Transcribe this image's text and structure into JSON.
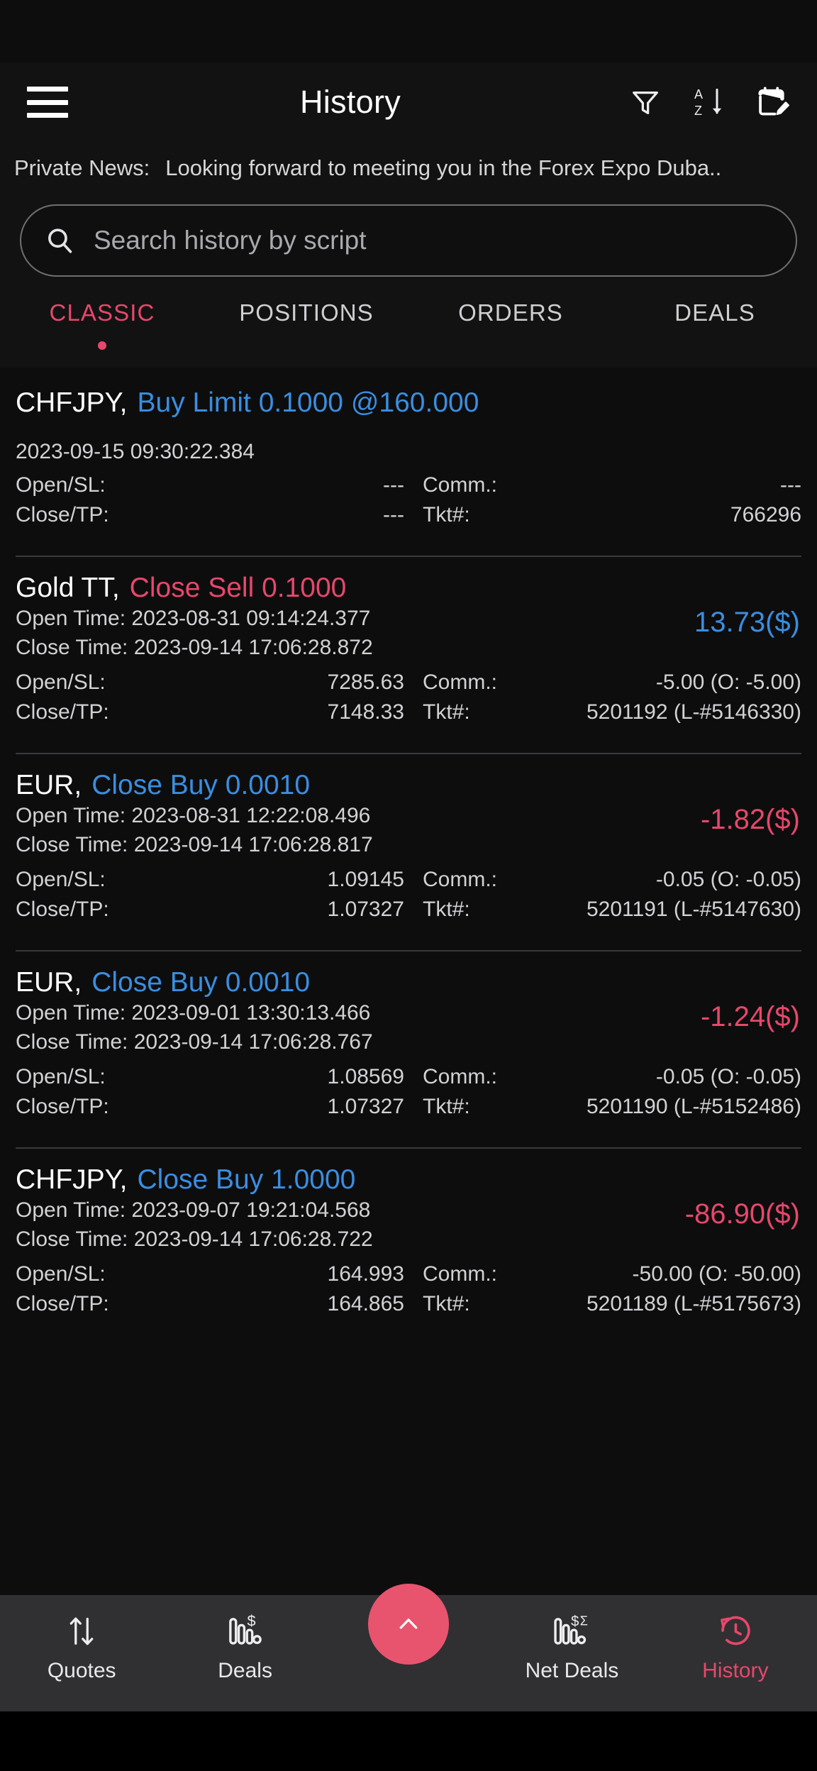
{
  "app": {
    "title": "History",
    "menu_icon": "hamburger-menu-icon",
    "actions": [
      {
        "name": "filter-icon",
        "label": "Filter"
      },
      {
        "name": "sort-az-icon",
        "label": "Sort A-Z"
      },
      {
        "name": "calendar-edit-icon",
        "label": "Date Range"
      }
    ]
  },
  "news": {
    "label": "Private News:",
    "text": "Looking forward to meeting you in the Forex Expo Duba.."
  },
  "search": {
    "placeholder": "Search history by script",
    "value": "",
    "icon": "search-icon"
  },
  "tabs": [
    {
      "label": "CLASSIC",
      "active": true
    },
    {
      "label": "POSITIONS",
      "active": false
    },
    {
      "label": "ORDERS",
      "active": false
    },
    {
      "label": "DEALS",
      "active": false
    }
  ],
  "labels": {
    "open_sl": "Open/SL:",
    "close_tp": "Close/TP:",
    "comm": "Comm.:",
    "ticket": "Tkt#:",
    "open_time": "Open Time:",
    "close_time": "Close Time:"
  },
  "entries": [
    {
      "type": "pending",
      "symbol": "CHFJPY,",
      "action": "Buy Limit 0.1000 @160.000",
      "action_color": "buy",
      "timestamp": "2023-09-15 09:30:22.384",
      "pnl": "",
      "pnl_sign": "",
      "open_sl": "---",
      "close_tp": "---",
      "comm": "---",
      "ticket": "766296"
    },
    {
      "type": "closed",
      "symbol": "Gold TT,",
      "action": "Close Sell 0.1000",
      "action_color": "sell",
      "open_time": "Open Time: 2023-08-31 09:14:24.377",
      "close_time": "Close Time: 2023-09-14 17:06:28.872",
      "pnl": "13.73($)",
      "pnl_sign": "pos",
      "open_sl": "7285.63",
      "close_tp": "7148.33",
      "comm": "-5.00 (O: -5.00)",
      "ticket": "5201192 (L-#5146330)"
    },
    {
      "type": "closed",
      "symbol": "EUR,",
      "action": "Close Buy 0.0010",
      "action_color": "buy",
      "open_time": "Open Time: 2023-08-31 12:22:08.496",
      "close_time": "Close Time: 2023-09-14 17:06:28.817",
      "pnl": "-1.82($)",
      "pnl_sign": "neg",
      "open_sl": "1.09145",
      "close_tp": "1.07327",
      "comm": "-0.05 (O: -0.05)",
      "ticket": "5201191 (L-#5147630)"
    },
    {
      "type": "closed",
      "symbol": "EUR,",
      "action": "Close Buy 0.0010",
      "action_color": "buy",
      "open_time": "Open Time: 2023-09-01 13:30:13.466",
      "close_time": "Close Time: 2023-09-14 17:06:28.767",
      "pnl": "-1.24($)",
      "pnl_sign": "neg",
      "open_sl": "1.08569",
      "close_tp": "1.07327",
      "comm": "-0.05 (O: -0.05)",
      "ticket": "5201190 (L-#5152486)"
    },
    {
      "type": "closed",
      "symbol": "CHFJPY,",
      "action": "Close Buy 1.0000",
      "action_color": "buy",
      "open_time": "Open Time: 2023-09-07 19:21:04.568",
      "close_time": "Close Time: 2023-09-14 17:06:28.722",
      "pnl": "-86.90($)",
      "pnl_sign": "neg",
      "open_sl": "164.993",
      "close_tp": "164.865",
      "comm": "-50.00 (O: -50.00)",
      "ticket": "5201189 (L-#5175673)"
    }
  ],
  "bottom_nav": {
    "items": [
      {
        "label": "Quotes",
        "icon": "arrows-up-down-icon",
        "active": false
      },
      {
        "label": "Deals",
        "icon": "bar-chart-dollar-icon",
        "active": false
      },
      {
        "label": "Net Deals",
        "icon": "bar-chart-sigma-icon",
        "active": false
      },
      {
        "label": "History",
        "icon": "history-clock-icon",
        "active": true
      }
    ],
    "fab": {
      "icon": "chevron-up-icon"
    }
  },
  "colors": {
    "accent": "#e8476b",
    "buy": "#3a8ee0",
    "sell": "#e8476b",
    "background": "#0d0d0e",
    "nav_background": "#303032"
  }
}
